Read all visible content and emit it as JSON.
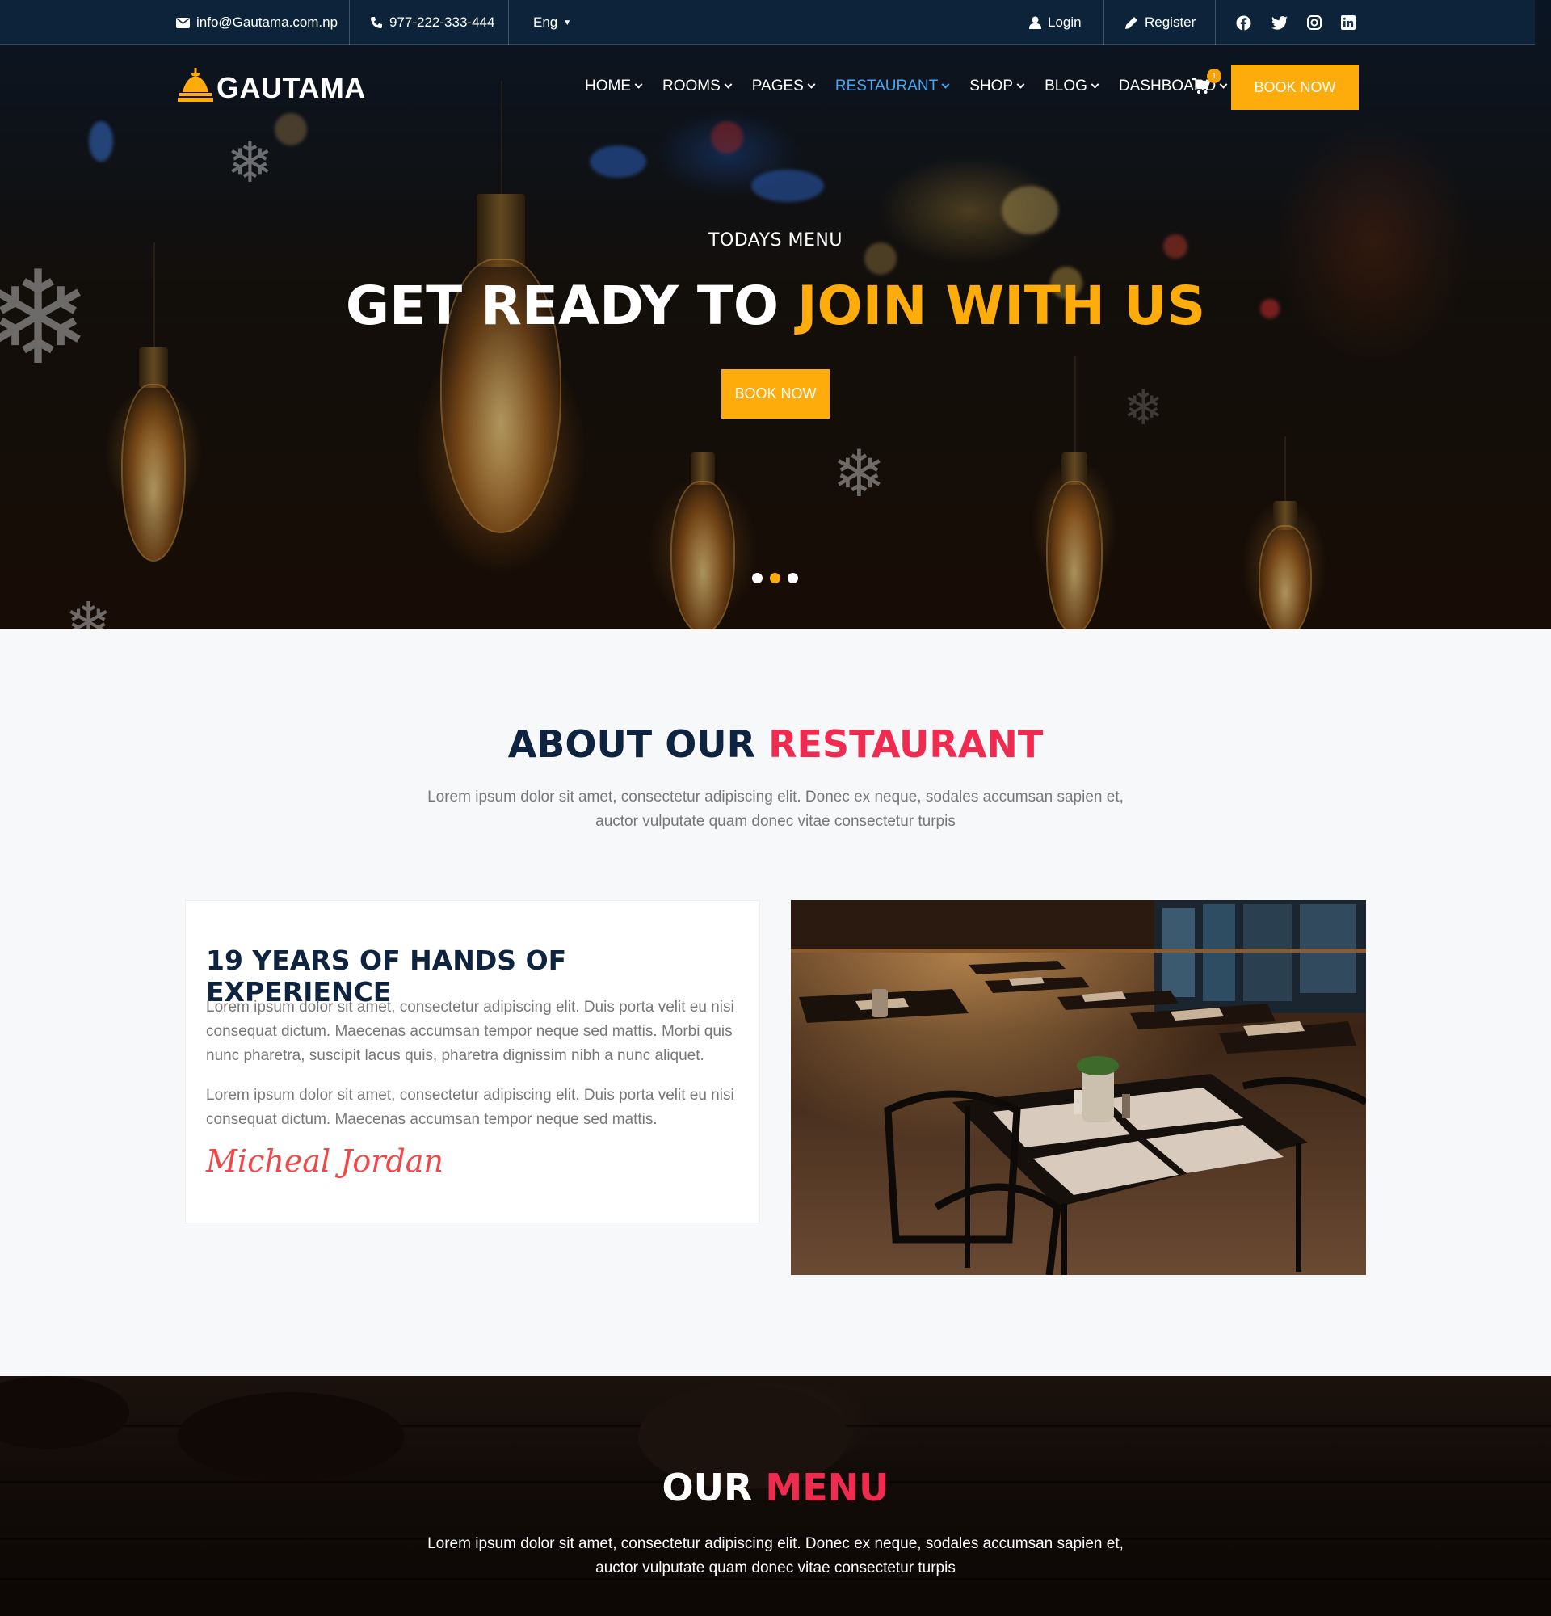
{
  "topbar": {
    "email": "info@Gautama.com.np",
    "phone": "977-222-333-444",
    "language": "Eng",
    "login": "Login",
    "register": "Register",
    "social_icons": [
      "facebook-icon",
      "twitter-icon",
      "instagram-icon",
      "linkedin-icon"
    ]
  },
  "brand": {
    "name": "GAUTAMA"
  },
  "nav": {
    "items": [
      "HOME",
      "ROOMS",
      "PAGES",
      "RESTAURANT",
      "SHOP",
      "BLOG",
      "DASHBOARD"
    ],
    "active": "RESTAURANT",
    "cart_count": "1",
    "book_now": "BOOK NOW"
  },
  "hero": {
    "subtitle": "TODAYS MENU",
    "title_part1": "GET READY TO ",
    "title_highlight": "JOIN WITH US",
    "button": "BOOK NOW",
    "slides": 3,
    "active_slide": 2
  },
  "about": {
    "title_part1": "ABOUT OUR ",
    "title_highlight": "RESTAURANT",
    "description": "Lorem ipsum dolor sit amet, consectetur adipiscing elit. Donec ex neque, sodales accumsan sapien et, auctor vulputate quam donec vitae consectetur turpis",
    "card_title": "19 YEARS OF HANDS OF EXPERIENCE",
    "paragraph1": "Lorem ipsum dolor sit amet, consectetur adipiscing elit. Duis porta velit eu nisi consequat dictum. Maecenas accumsan tempor neque sed mattis. Morbi quis nunc pharetra, suscipit lacus quis, pharetra dignissim nibh a nunc aliquet.",
    "paragraph2": "Lorem ipsum dolor sit amet, consectetur adipiscing elit. Duis porta velit eu nisi consequat dictum. Maecenas accumsan tempor neque sed mattis.",
    "signature": "Micheal Jordan"
  },
  "menu": {
    "title_part1": "OUR ",
    "title_highlight": "MENU",
    "description": "Lorem ipsum dolor sit amet, consectetur adipiscing elit. Donec ex neque, sodales accumsan sapien et, auctor vulputate quam donec vitae consectetur turpis"
  },
  "colors": {
    "accent": "#fdac0c",
    "highlight_red": "#f02b4f",
    "nav_active": "#3fa9f5",
    "heading_navy": "#0d2340"
  }
}
